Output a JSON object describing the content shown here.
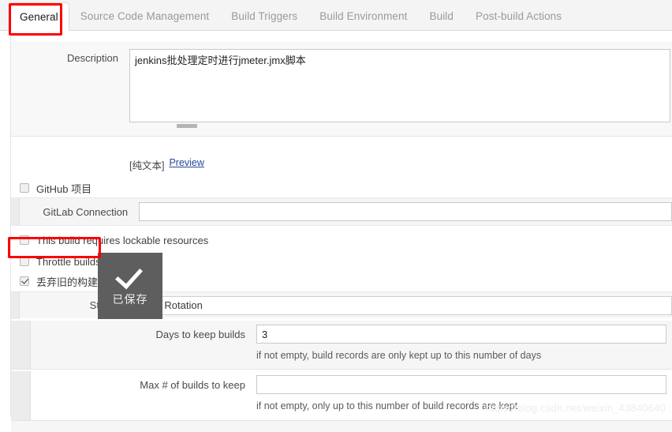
{
  "tabs": [
    {
      "label": "General",
      "active": true
    },
    {
      "label": "Source Code Management",
      "active": false
    },
    {
      "label": "Build Triggers",
      "active": false
    },
    {
      "label": "Build Environment",
      "active": false
    },
    {
      "label": "Build",
      "active": false
    },
    {
      "label": "Post-build Actions",
      "active": false
    }
  ],
  "description": {
    "label": "Description",
    "value": "jenkins批处理定时进行jmeter.jmx脚本",
    "plaintext_tag": "[纯文本]",
    "preview_link": "Preview"
  },
  "github_project": {
    "label": "GitHub 项目",
    "checked": false
  },
  "gitlab_connection": {
    "label": "GitLab Connection",
    "value": ""
  },
  "lockable_resources": {
    "label": "This build requires lockable resources",
    "checked": false
  },
  "throttle_builds": {
    "label": "Throttle builds",
    "checked": false
  },
  "discard_old_builds": {
    "label": "丢弃旧的构建",
    "checked": true
  },
  "strategy": {
    "label": "Strategy",
    "selected": "Log Rotation"
  },
  "days_to_keep": {
    "label": "Days to keep builds",
    "value": "3",
    "help": "if not empty, build records are only kept up to this number of days"
  },
  "max_builds_to_keep": {
    "label": "Max # of builds to keep",
    "value": "",
    "help": "if not empty, only up to this number of build records are kept"
  },
  "toast": {
    "icon": "check-icon",
    "label": "已保存"
  },
  "watermark": "https://blog.csdn.net/weixin_43840640",
  "colors": {
    "annotation": "#fe0000",
    "link": "#214a9c",
    "toast_bg": "#5e5e5e"
  }
}
